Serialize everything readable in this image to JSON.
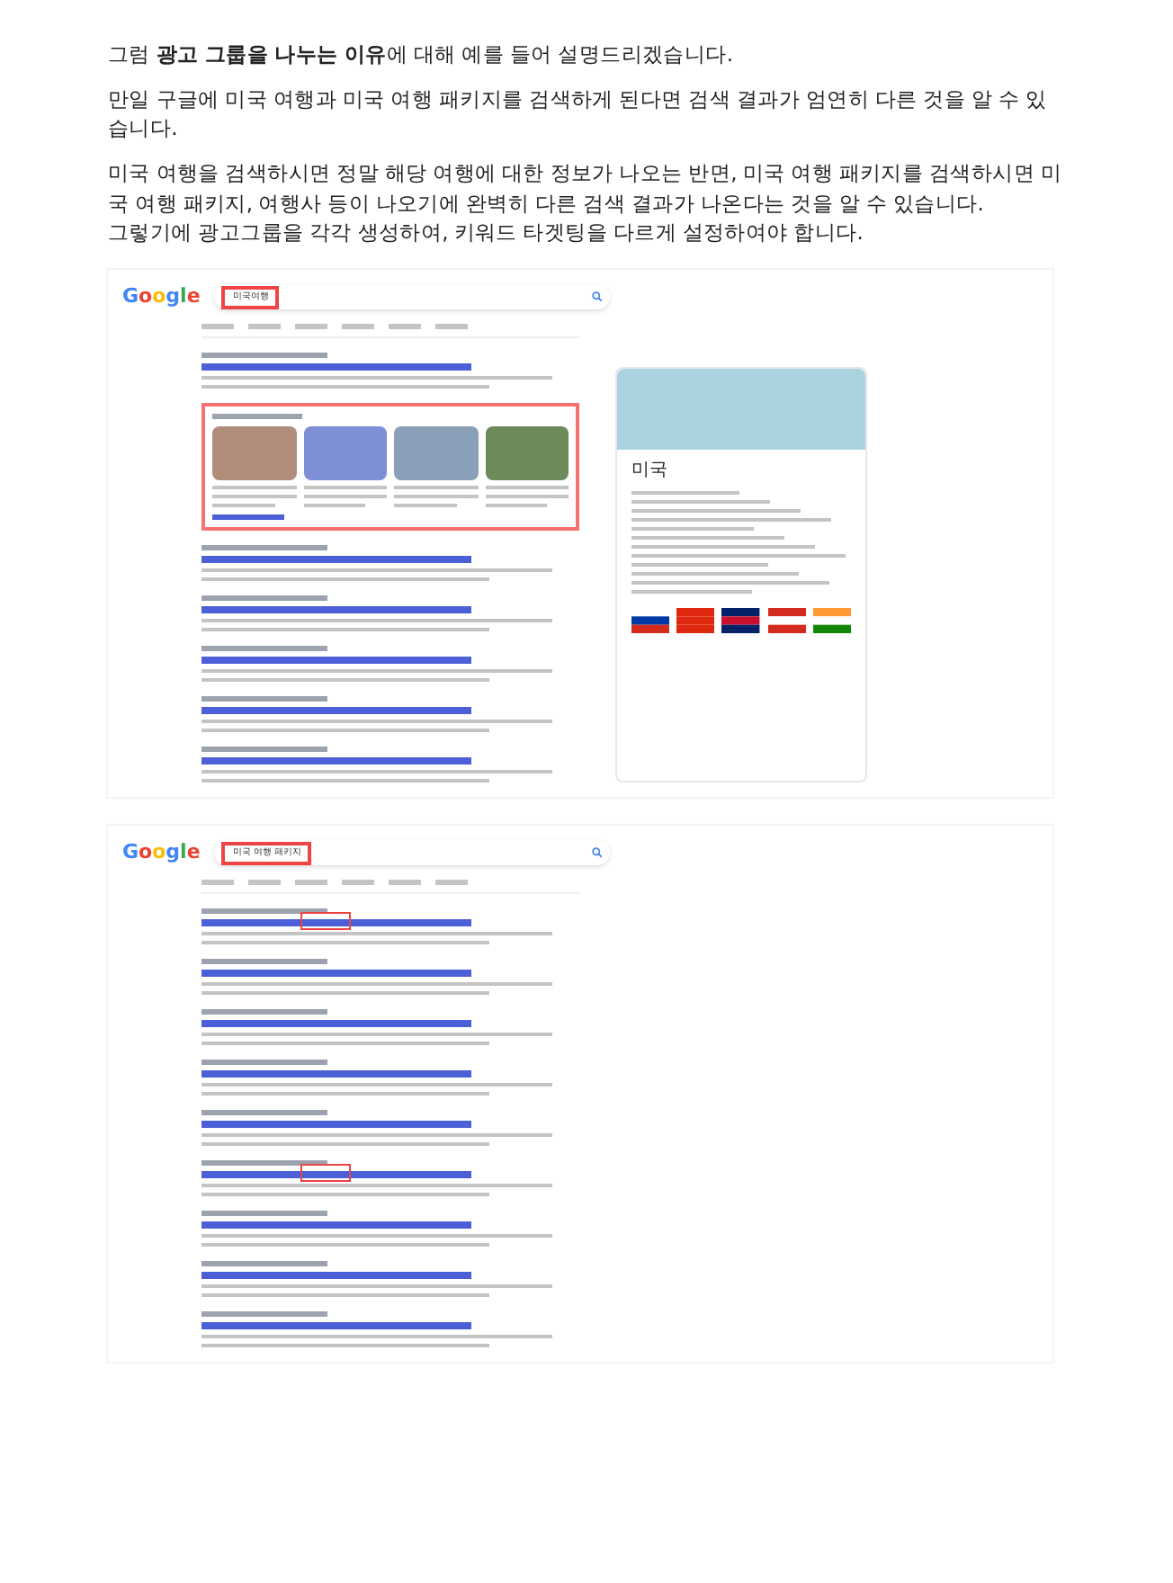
{
  "paragraphs": [
    "그럼 **광고 그룹을 나누는 이유**에 대해 예를 들어 설명드리겠습니다.",
    "만일 구글에 미국 여행과 미국 여행 패키지를 검색하게 된다면 검색 결과가 엄연히 다른 것을 알 수 있습니다.",
    "미국 여행을 검색하시면 정말 해당 여행에 대한 정보가 나오는 반면, 미국 여행 패키지를 검색하시면 미국 여행 패키지, 여행사 등이 나오기에 완벽히 다른 검색 결과가 나온다는 것을 알 수 있습니다.\n그렇기에 광고그룹을 각각 생성하여, 키워드 타겟팅을 다르게 설정하여야 합니다."
  ],
  "screenshots": [
    {
      "kind": "overview",
      "logo": "Google",
      "query": "미국여행",
      "panel": {
        "title": "미국"
      }
    },
    {
      "kind": "listing",
      "logo": "Google",
      "query": "미국 여행 패키지"
    }
  ]
}
